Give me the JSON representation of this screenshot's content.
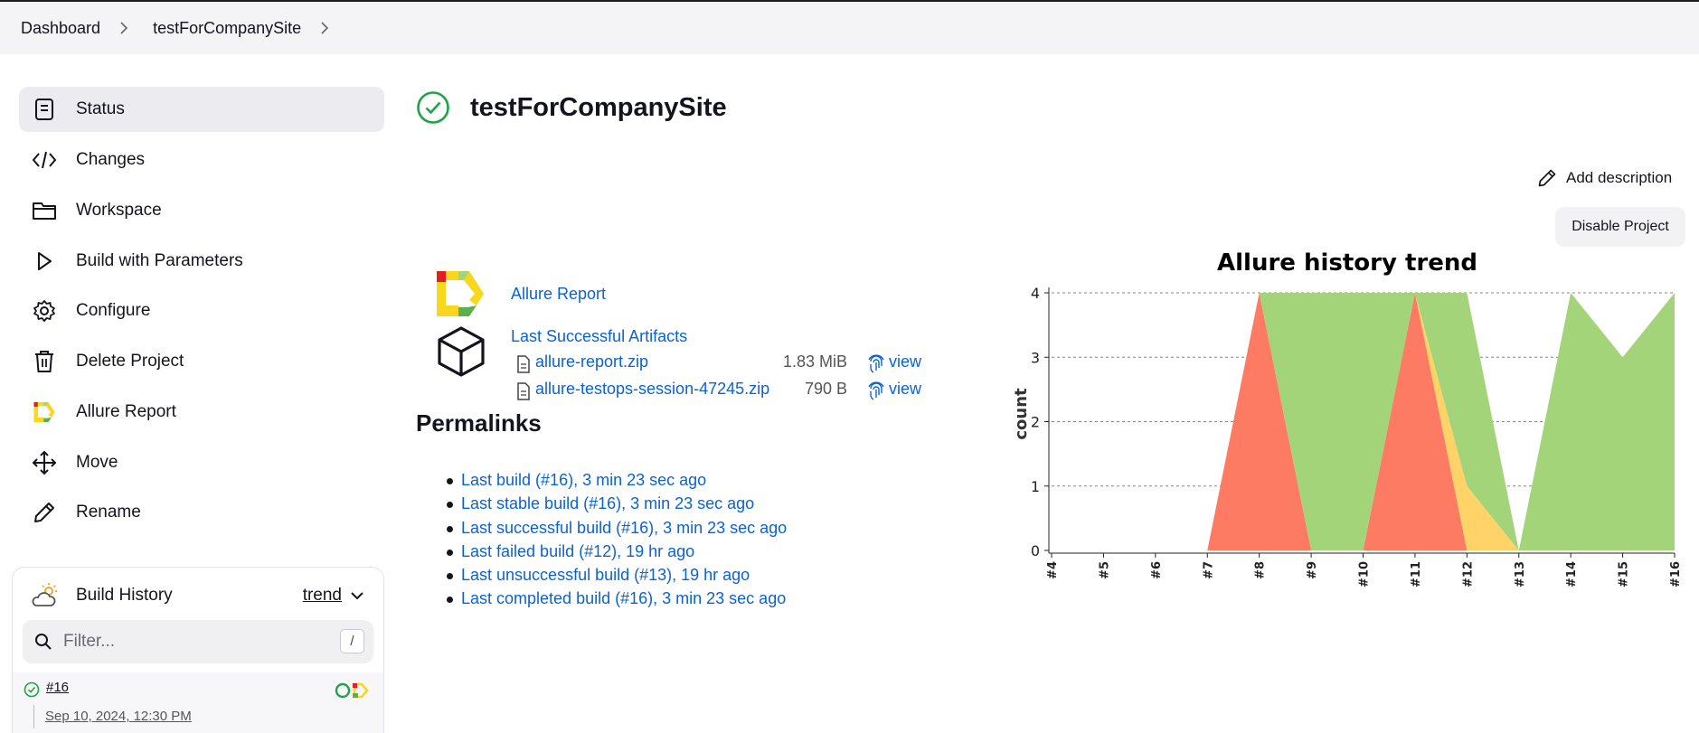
{
  "breadcrumb": {
    "items": [
      "Dashboard",
      "testForCompanySite"
    ]
  },
  "sidebar": {
    "tasks": [
      {
        "label": "Status",
        "icon": "status-icon"
      },
      {
        "label": "Changes",
        "icon": "code-icon"
      },
      {
        "label": "Workspace",
        "icon": "folder-icon"
      },
      {
        "label": "Build with Parameters",
        "icon": "play-icon"
      },
      {
        "label": "Configure",
        "icon": "gear-icon"
      },
      {
        "label": "Delete Project",
        "icon": "trash-icon"
      },
      {
        "label": "Allure Report",
        "icon": "allure-logo-icon"
      },
      {
        "label": "Move",
        "icon": "move-icon"
      },
      {
        "label": "Rename",
        "icon": "pencil-icon"
      }
    ]
  },
  "build_history": {
    "title": "Build History",
    "trend_label": "trend",
    "filter_placeholder": "Filter...",
    "filter_shortcut": "/",
    "builds": [
      {
        "number": "#16",
        "date": "Sep 10, 2024, 12:30 PM",
        "status": "success"
      }
    ]
  },
  "main": {
    "title": "testForCompanySite",
    "status": "success",
    "add_description": "Add description",
    "disable_project": "Disable Project",
    "allure_report_link": "Allure Report",
    "last_successful_artifacts": "Last Successful Artifacts",
    "artifacts": [
      {
        "name": "allure-report.zip",
        "size": "1.83 MiB",
        "action": "view"
      },
      {
        "name": "allure-testops-session-47245.zip",
        "size": "790 B",
        "action": "view"
      }
    ],
    "permalinks_title": "Permalinks",
    "permalinks": [
      "Last build (#16), 3 min 23 sec ago",
      "Last stable build (#16), 3 min 23 sec ago",
      "Last successful build (#16), 3 min 23 sec ago",
      "Last failed build (#12), 19 hr ago",
      "Last unsuccessful build (#13), 19 hr ago",
      "Last completed build (#16), 3 min 23 sec ago"
    ]
  },
  "colors": {
    "link": "#0b63d1",
    "failed": "#fd7b63",
    "broken": "#ffd368",
    "passed": "#a4d47a",
    "success_icon": "#1ea446"
  },
  "chart_data": {
    "type": "area",
    "title": "Allure history trend",
    "xlabel": "",
    "ylabel": "count",
    "x": [
      "#4",
      "#5",
      "#6",
      "#7",
      "#8",
      "#9",
      "#10",
      "#11",
      "#12",
      "#13",
      "#14",
      "#15",
      "#16"
    ],
    "ylim": [
      0,
      4
    ],
    "yticks": [
      0,
      1,
      2,
      3,
      4
    ],
    "grid": true,
    "series": [
      {
        "key": "failed",
        "color": "#fd7b63",
        "values": [
          0,
          0,
          0,
          0,
          4,
          0,
          0,
          4,
          0,
          0,
          0,
          0,
          0
        ]
      },
      {
        "key": "broken",
        "color": "#ffd368",
        "values": [
          0,
          0,
          0,
          0,
          0,
          0,
          0,
          0,
          1,
          0,
          0,
          0,
          0
        ]
      },
      {
        "key": "passed",
        "color": "#a4d47a",
        "values": [
          0,
          0,
          0,
          0,
          0,
          4,
          4,
          0,
          3,
          0,
          4,
          3,
          4
        ]
      }
    ]
  }
}
